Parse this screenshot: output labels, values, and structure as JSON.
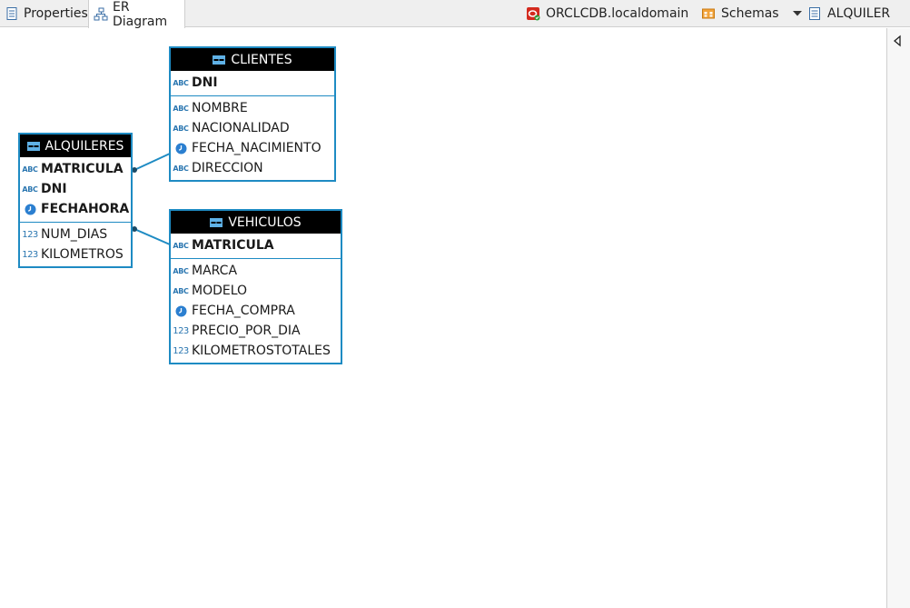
{
  "tabs": [
    {
      "label": "Properties"
    },
    {
      "label": "ER Diagram"
    }
  ],
  "toolbar": {
    "connection": "ORCLCDB.localdomain",
    "schemas": "Schemas",
    "database": "ALQUILER"
  },
  "colors": {
    "entity_border": "#1e8bc3",
    "header_bg": "#000000",
    "type_icon": "#2a76b0",
    "clock_icon": "#2b7fd0"
  },
  "entities": {
    "clientes": {
      "name": "CLIENTES",
      "keys": [
        {
          "name": "DNI",
          "type": "abc"
        }
      ],
      "attributes": [
        {
          "name": "NOMBRE",
          "type": "abc"
        },
        {
          "name": "NACIONALIDAD",
          "type": "abc"
        },
        {
          "name": "FECHA_NACIMIENTO",
          "type": "date"
        },
        {
          "name": "DIRECCION",
          "type": "abc"
        }
      ]
    },
    "alquileres": {
      "name": "ALQUILERES",
      "keys": [
        {
          "name": "MATRICULA",
          "type": "abc"
        },
        {
          "name": "DNI",
          "type": "abc"
        },
        {
          "name": "FECHAHORA",
          "type": "date"
        }
      ],
      "attributes": [
        {
          "name": "NUM_DIAS",
          "type": "number"
        },
        {
          "name": "KILOMETROS",
          "type": "number"
        }
      ]
    },
    "vehiculos": {
      "name": "VEHICULOS",
      "keys": [
        {
          "name": "MATRICULA",
          "type": "abc"
        }
      ],
      "attributes": [
        {
          "name": "MARCA",
          "type": "abc"
        },
        {
          "name": "MODELO",
          "type": "abc"
        },
        {
          "name": "FECHA_COMPRA",
          "type": "date"
        },
        {
          "name": "PRECIO_POR_DIA",
          "type": "number"
        },
        {
          "name": "KILOMETROSTOTALES",
          "type": "number"
        }
      ]
    }
  },
  "type_icons": {
    "abc": {
      "glyph": "ABC",
      "icon": "text-type-icon"
    },
    "number": {
      "glyph": "123",
      "icon": "number-type-icon"
    },
    "date": {
      "icon": "clock-icon"
    }
  },
  "relations": [
    {
      "from": "alquileres",
      "to": "clientes"
    },
    {
      "from": "alquileres",
      "to": "vehiculos"
    }
  ]
}
